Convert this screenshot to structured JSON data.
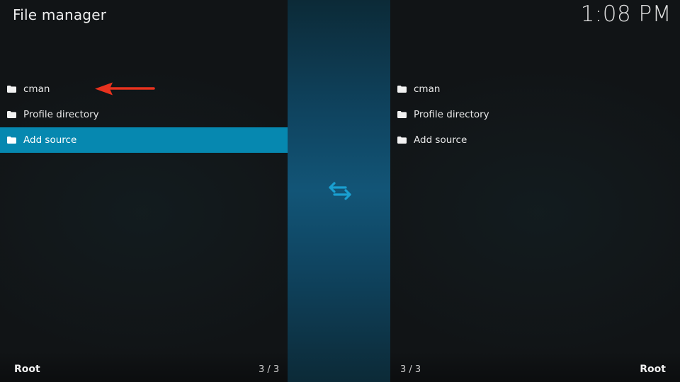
{
  "header": {
    "title": "File manager",
    "clock": "1:08 PM"
  },
  "left_pane": {
    "items": [
      {
        "label": "cman",
        "icon": "folder-icon"
      },
      {
        "label": "Profile directory",
        "icon": "folder-icon"
      },
      {
        "label": "Add source",
        "icon": "folder-icon"
      }
    ],
    "focused_index": 2,
    "footer": {
      "path": "Root",
      "count": "3 / 3"
    }
  },
  "right_pane": {
    "items": [
      {
        "label": "cman",
        "icon": "folder-icon"
      },
      {
        "label": "Profile directory",
        "icon": "folder-icon"
      },
      {
        "label": "Add source",
        "icon": "folder-icon"
      }
    ],
    "footer": {
      "path": "Root",
      "count": "3 / 3"
    }
  },
  "center": {
    "icon": "swap-arrows-icon"
  },
  "annotation": {
    "icon": "red-arrow-icon"
  },
  "colors": {
    "accent": "#0688b0",
    "arrow": "#e8321e",
    "swap": "#1a9fd0"
  }
}
